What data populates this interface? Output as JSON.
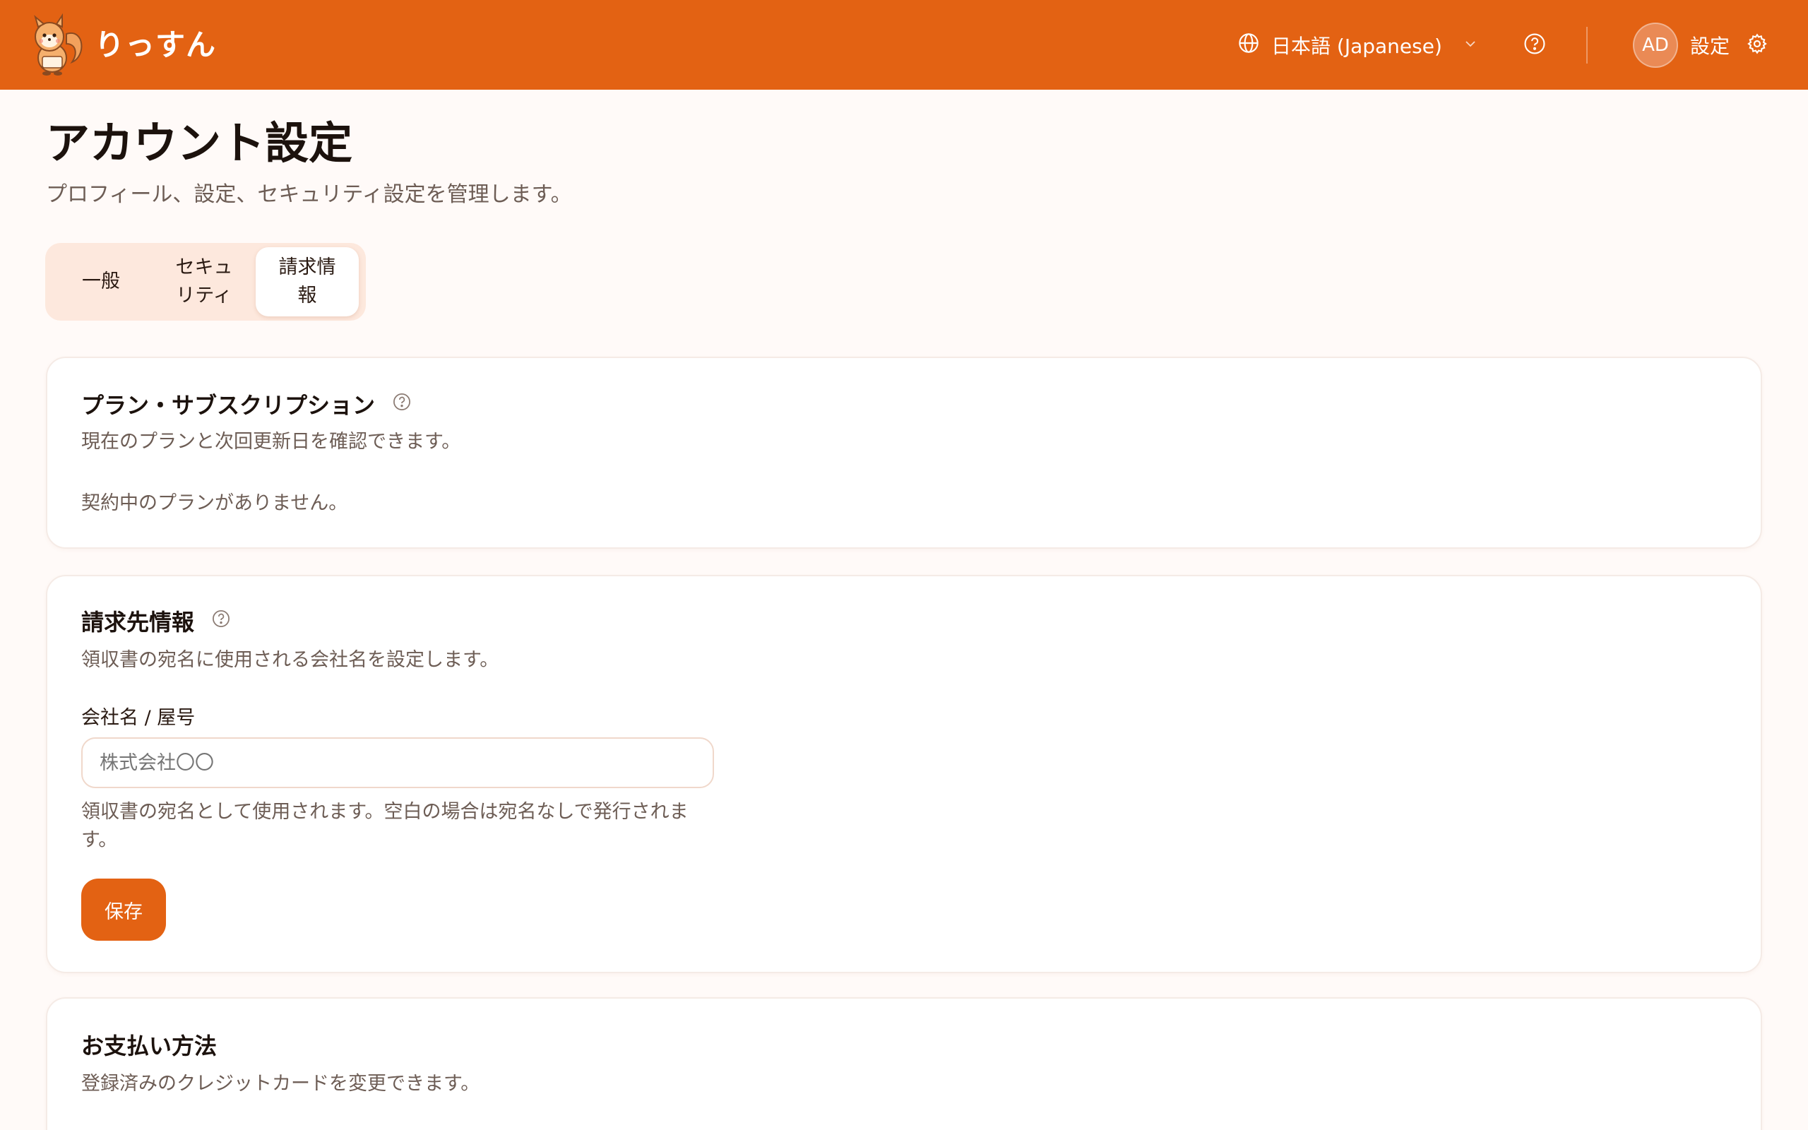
{
  "header": {
    "brand": "りっすん",
    "language": "日本語 (Japanese)",
    "avatar_initials": "AD",
    "settings_label": "設定",
    "accent_color": "#e36213"
  },
  "page": {
    "title": "アカウント設定",
    "description": "プロフィール、設定、セキュリティ設定を管理します。"
  },
  "tabs": [
    {
      "label": "一般"
    },
    {
      "label": "セキュリティ"
    },
    {
      "label": "請求情報",
      "active": true
    }
  ],
  "plan": {
    "title": "プラン・サブスクリプション",
    "description": "現在のプランと次回更新日を確認できます。",
    "empty_text": "契約中のプランがありません。"
  },
  "billing": {
    "title": "請求先情報",
    "description": "領収書の宛名に使用される会社名を設定します。",
    "field_label": "会社名 / 屋号",
    "placeholder": "株式会社〇〇",
    "value": "",
    "hint": "領収書の宛名として使用されます。空白の場合は宛名なしで発行されます。",
    "save_label": "保存"
  },
  "payment": {
    "title": "お支払い方法",
    "description": "登録済みのクレジットカードを変更できます。"
  },
  "icons": {
    "globe": "globe-icon",
    "help": "help-circle-icon",
    "gear": "gear-icon",
    "chevron": "chevron-down-icon"
  }
}
